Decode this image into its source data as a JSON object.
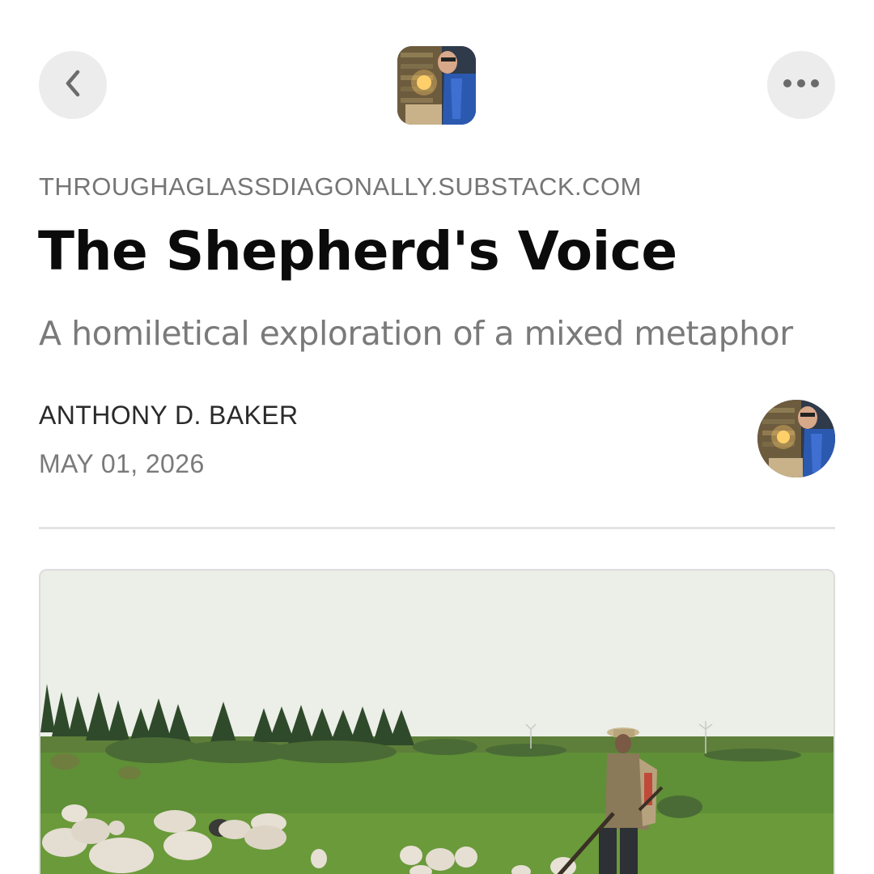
{
  "nav": {
    "back_icon": "chevron-left-icon",
    "more_icon": "ellipsis-horizontal-icon"
  },
  "publication": {
    "domain": "THROUGHAGLASSDIAGONALLY.SUBSTACK.COM"
  },
  "post": {
    "title": "The Shepherd's Voice",
    "subtitle": "A homiletical exploration of a mixed metaphor",
    "author": "ANTHONY D. BAKER",
    "date": "MAY 01, 2026"
  },
  "colors": {
    "background": "#ffffff",
    "button_bg": "#ececec",
    "title": "#0b0b0b",
    "muted_text": "#7a7a7a",
    "divider": "#e3e3e3"
  }
}
